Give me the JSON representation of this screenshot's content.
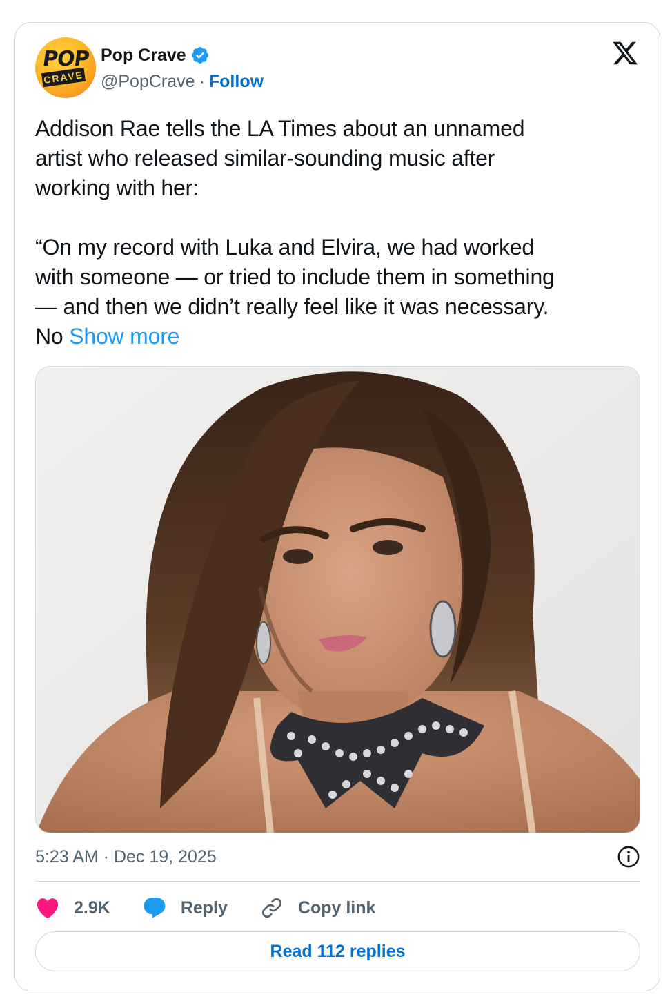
{
  "author": {
    "name": "Pop Crave",
    "handle": "@PopCrave",
    "follow_label": "Follow",
    "separator": "·",
    "avatar_text_top": "POP",
    "avatar_text_bottom": "CRAVE",
    "verified": true
  },
  "tweet": {
    "paragraph_1": "Addison Rae tells the LA Times about an unnamed\nartist who released similar-sounding music after\nworking with her:",
    "paragraph_2_lines": "“On my record with Luka and Elvira, we had worked\nwith someone — or tried to include them in something\n— and then we didn’t really feel like it was necessary.",
    "truncated_tail": "No ",
    "show_more_label": "Show more",
    "timestamp": "5:23 AM · Dec 19, 2025"
  },
  "actions": {
    "likes_count": "2.9K",
    "reply_label": "Reply",
    "copy_link_label": "Copy link"
  },
  "read_replies_label": "Read 112 replies",
  "icons": {
    "logo": "x-logo-icon",
    "verified": "verified-badge-icon",
    "info": "info-icon",
    "like": "heart-icon",
    "reply": "speech-bubble-icon",
    "copy": "link-icon"
  },
  "colors": {
    "link_blue": "#006fd6",
    "show_more_blue": "#1d9bf0",
    "heart_pink": "#f91880",
    "reply_blue": "#1d9bf0",
    "text_secondary": "#536471"
  }
}
